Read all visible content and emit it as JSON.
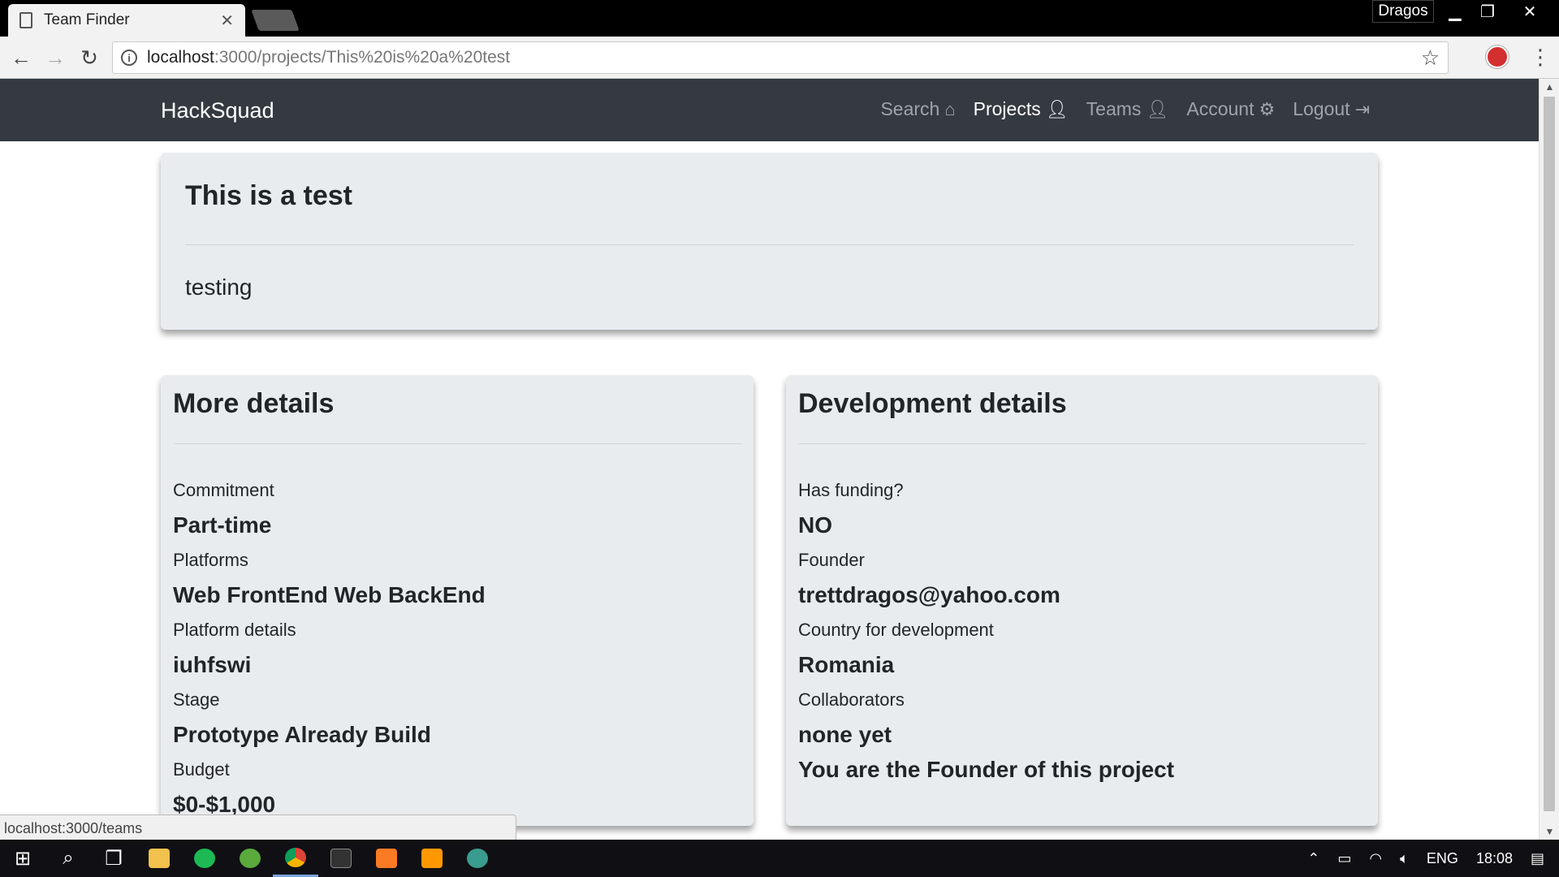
{
  "browser": {
    "tab_title": "Team Finder",
    "profile_name": "Dragos",
    "url_host": "localhost",
    "url_path": ":3000/projects/This%20is%20a%20test",
    "status_url": "localhost:3000/teams"
  },
  "navbar": {
    "brand": "HackSquad",
    "links": [
      {
        "label": "Search",
        "icon": "home-icon"
      },
      {
        "label": "Projects",
        "icon": "user-icon",
        "active": true
      },
      {
        "label": "Teams",
        "icon": "user-icon"
      },
      {
        "label": "Account",
        "icon": "gears-icon"
      },
      {
        "label": "Logout",
        "icon": "sign-out-icon"
      }
    ]
  },
  "project": {
    "title": "This is a test",
    "description": "testing"
  },
  "more_details": {
    "heading": "More details",
    "fields": [
      {
        "label": "Commitment",
        "value": "Part-time"
      },
      {
        "label": "Platforms",
        "value": "Web FrontEnd Web BackEnd"
      },
      {
        "label": "Platform details",
        "value": "iuhfswi"
      },
      {
        "label": "Stage",
        "value": "Prototype Already Build"
      },
      {
        "label": "Budget",
        "value": "$0-$1,000"
      }
    ]
  },
  "development_details": {
    "heading": "Development details",
    "fields": [
      {
        "label": "Has funding?",
        "value": "NO"
      },
      {
        "label": "Founder",
        "value": "trettdragos@yahoo.com"
      },
      {
        "label": "Country for development",
        "value": "Romania"
      },
      {
        "label": "Collaborators",
        "value": "none yet"
      }
    ],
    "note": "You are the Founder of this project"
  },
  "taskbar": {
    "language": "ENG",
    "time": "18:08"
  }
}
